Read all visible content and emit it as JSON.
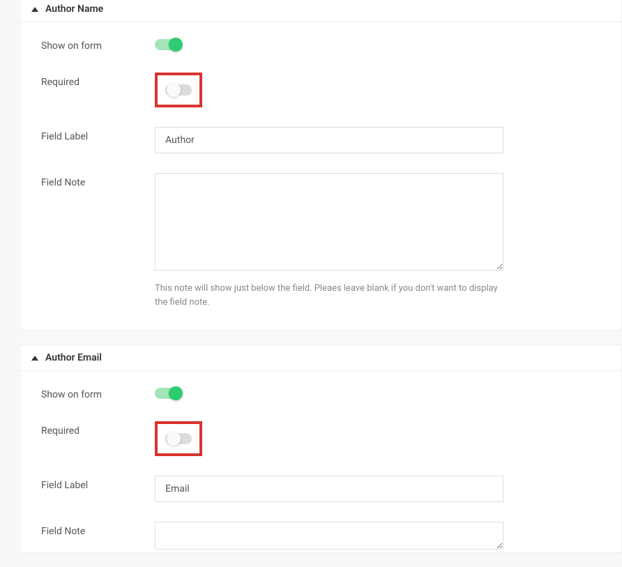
{
  "sections": [
    {
      "title": "Author Name",
      "show_on_form_label": "Show on form",
      "show_on_form_state": "on",
      "required_label": "Required",
      "required_state": "off",
      "required_highlighted": true,
      "field_label_label": "Field Label",
      "field_label_value": "Author",
      "field_note_label": "Field Note",
      "field_note_value": "",
      "field_note_helper": "This note will show just below the field. Pleaes leave blank if you don't want to display the field note."
    },
    {
      "title": "Author Email",
      "show_on_form_label": "Show on form",
      "show_on_form_state": "on",
      "required_label": "Required",
      "required_state": "off",
      "required_highlighted": true,
      "field_label_label": "Field Label",
      "field_label_value": "Email",
      "field_note_label": "Field Note",
      "field_note_value": "",
      "field_note_helper": ""
    }
  ]
}
